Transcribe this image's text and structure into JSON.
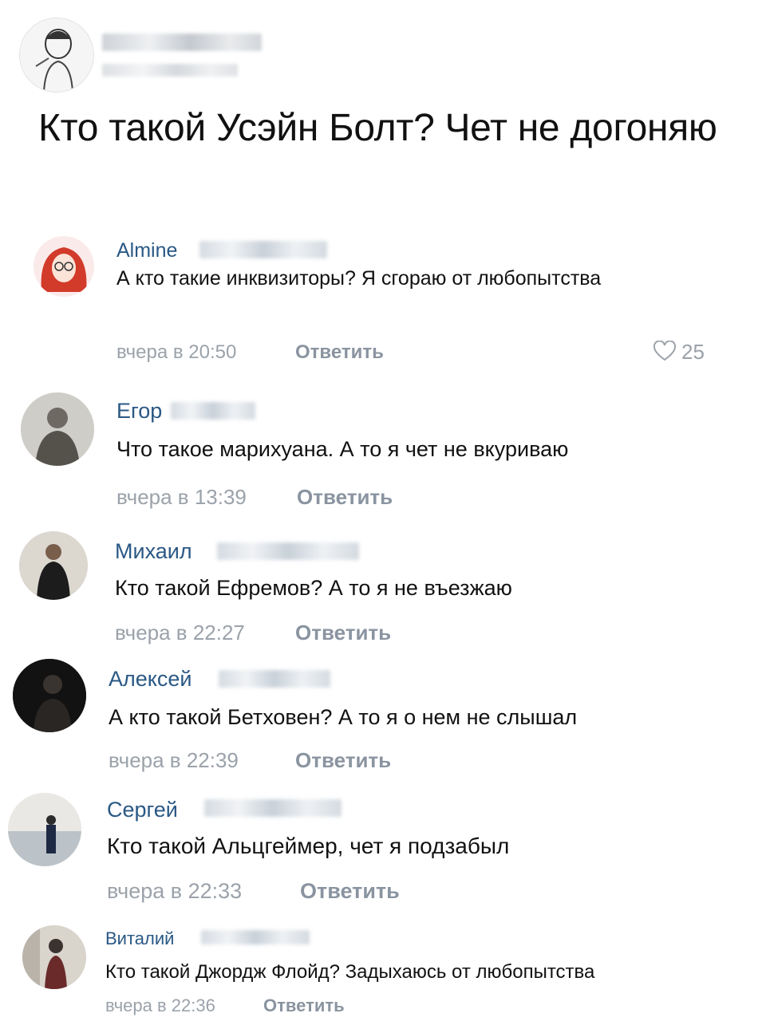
{
  "post": {
    "title": "Кто такой Усэйн Болт? Чет не догоняю"
  },
  "comments": [
    {
      "name": "Almine",
      "text": "А кто такие инквизиторы? Я сгораю от любопытства",
      "time": "вчера в 20:50",
      "reply": "Ответить",
      "likes": "25"
    },
    {
      "name": "Егор",
      "text": "Что такое марихуана. А то я чет не вкуриваю",
      "time": "вчера в 13:39",
      "reply": "Ответить"
    },
    {
      "name": "Михаил",
      "text": "Кто такой Ефремов? А то я не въезжаю",
      "time": "вчера в 22:27",
      "reply": "Ответить"
    },
    {
      "name": "Алексей",
      "text": "А кто такой Бетховен? А то я о нем не слышал",
      "time": "вчера в 22:39",
      "reply": "Ответить"
    },
    {
      "name": "Сергей",
      "text": "Кто такой Альцгеймер, чет я подзабыл",
      "time": "вчера в 22:33",
      "reply": "Ответить"
    },
    {
      "name": "Виталий",
      "text": "Кто такой Джордж Флойд? Задыхаюсь от любопытства",
      "time": "вчера в 22:36",
      "reply": "Ответить"
    }
  ],
  "colors": {
    "link": "#2a5885",
    "meta": "#9ba2aa",
    "text": "#111111"
  },
  "icons": {
    "like": "heart-outline-icon"
  }
}
